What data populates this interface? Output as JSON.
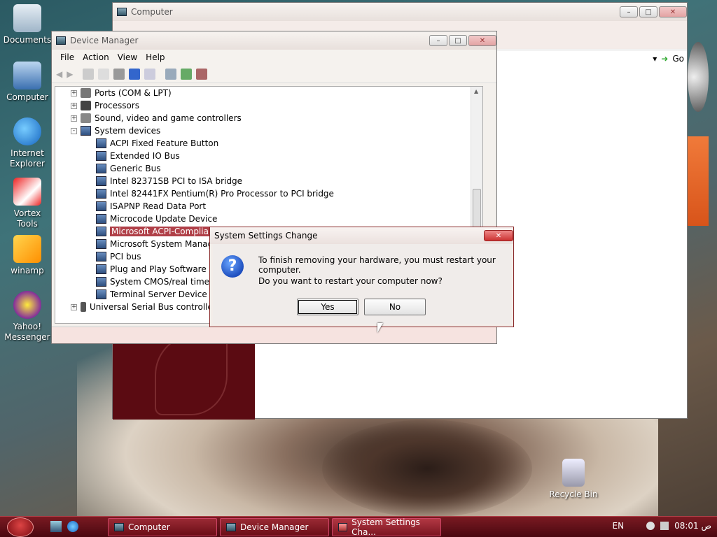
{
  "desktop": {
    "icons": [
      {
        "label": "Documents"
      },
      {
        "label": "Computer"
      },
      {
        "label": "Internet Explorer"
      },
      {
        "label": "Vortex Tools"
      },
      {
        "label": "winamp"
      },
      {
        "label": "Yahoo! Messenger"
      }
    ],
    "recycle_bin": "Recycle Bin"
  },
  "computer_window": {
    "title": "Computer",
    "go_label": "Go"
  },
  "device_manager": {
    "title": "Device Manager",
    "menu": [
      "File",
      "Action",
      "View",
      "Help"
    ],
    "tree": [
      {
        "label": "Ports (COM & LPT)",
        "level": 0,
        "expander": "+"
      },
      {
        "label": "Processors",
        "level": 0,
        "expander": "+"
      },
      {
        "label": "Sound, video and game controllers",
        "level": 0,
        "expander": "+"
      },
      {
        "label": "System devices",
        "level": 0,
        "expander": "-"
      },
      {
        "label": "ACPI Fixed Feature Button",
        "level": 1
      },
      {
        "label": "Extended IO Bus",
        "level": 1
      },
      {
        "label": "Generic Bus",
        "level": 1
      },
      {
        "label": "Intel 82371SB PCI to ISA bridge",
        "level": 1
      },
      {
        "label": "Intel 82441FX Pentium(R) Pro Processor to PCI bridge",
        "level": 1
      },
      {
        "label": "ISAPNP Read Data Port",
        "level": 1
      },
      {
        "label": "Microcode Update Device",
        "level": 1
      },
      {
        "label": "Microsoft ACPI-Compliant",
        "level": 1,
        "selected": true
      },
      {
        "label": "Microsoft System Manager",
        "level": 1
      },
      {
        "label": "PCI bus",
        "level": 1
      },
      {
        "label": "Plug and Play Software Dev",
        "level": 1
      },
      {
        "label": "System CMOS/real time clo",
        "level": 1
      },
      {
        "label": "Terminal Server Device Red",
        "level": 1
      },
      {
        "label": "Universal Serial Bus controllers",
        "level": 0,
        "expander": "+"
      }
    ]
  },
  "dialog": {
    "title": "System Settings Change",
    "message": "To finish removing your hardware, you must restart your computer.",
    "question": "Do you want to restart your computer now?",
    "yes": "Yes",
    "no": "No"
  },
  "taskbar": {
    "buttons": [
      "Computer",
      "Device Manager",
      "System Settings Cha..."
    ],
    "lang": "EN",
    "clock": "08:01 ص"
  }
}
